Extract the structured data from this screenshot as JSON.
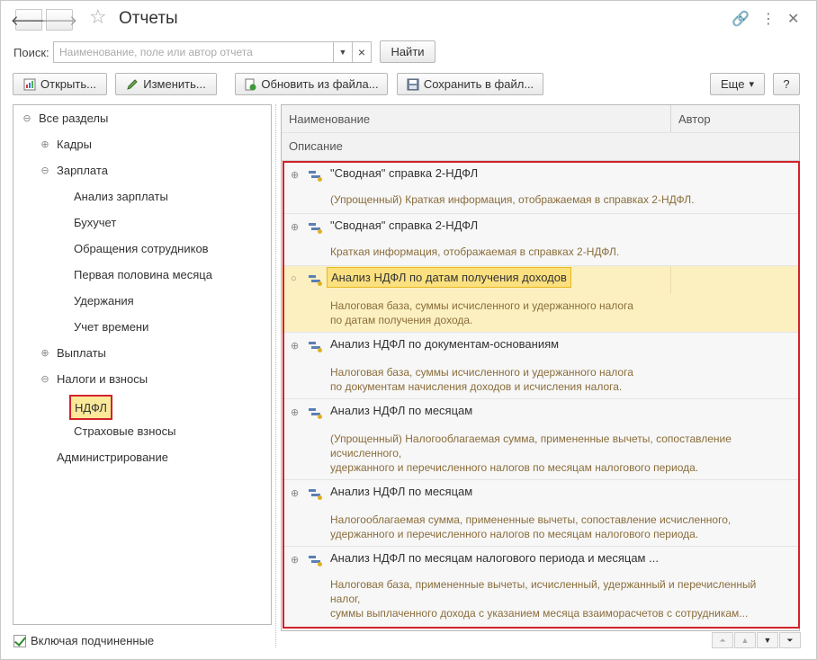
{
  "window": {
    "title": "Отчеты",
    "back_glyph": "🡐",
    "forward_glyph": "🡒",
    "star_glyph": "☆",
    "link_glyph": "🔗",
    "more_glyph": "⋮",
    "close_glyph": "✕"
  },
  "search": {
    "label": "Поиск:",
    "placeholder": "Наименование, поле или автор отчета",
    "dropdown_glyph": "▼",
    "clear_glyph": "×",
    "find_label": "Найти"
  },
  "toolbar": {
    "open_label": "Открыть...",
    "edit_label": "Изменить...",
    "update_label": "Обновить из файла...",
    "save_label": "Сохранить в файл...",
    "more_label": "Еще",
    "more_arrow": "▾",
    "help_label": "?"
  },
  "tree": {
    "items": [
      {
        "label": "Все разделы",
        "toggle": "⊖"
      },
      {
        "label": "Кадры",
        "toggle": "⊕"
      },
      {
        "label": "Зарплата",
        "toggle": "⊖"
      },
      {
        "label": "Анализ зарплаты"
      },
      {
        "label": "Бухучет"
      },
      {
        "label": "Обращения сотрудников"
      },
      {
        "label": "Первая половина месяца"
      },
      {
        "label": "Удержания"
      },
      {
        "label": "Учет времени"
      },
      {
        "label": "Выплаты",
        "toggle": "⊕"
      },
      {
        "label": "Налоги и взносы",
        "toggle": "⊖"
      },
      {
        "label": "НДФЛ"
      },
      {
        "label": "Страховые взносы"
      },
      {
        "label": "Администрирование"
      }
    ],
    "include_subordinate_label": "Включая подчиненные"
  },
  "table": {
    "col_name": "Наименование",
    "col_author": "Автор",
    "col_description": "Описание",
    "rows": [
      {
        "toggle": "⊕",
        "name": "\"Сводная\" справка 2-НДФЛ",
        "desc1": "(Упрощенный) Краткая информация, отображаемая в справках 2-НДФЛ.",
        "desc2": "",
        "desc3": ""
      },
      {
        "toggle": "⊕",
        "name": "\"Сводная\" справка 2-НДФЛ",
        "desc1": "Краткая информация, отображаемая в справках 2-НДФЛ.",
        "desc2": "",
        "desc3": ""
      },
      {
        "toggle": "○",
        "name": "Анализ НДФЛ по датам получения доходов",
        "desc1": "Налоговая база, суммы исчисленного и удержанного налога",
        "desc2": "по датам получения дохода.",
        "desc3": ""
      },
      {
        "toggle": "⊕",
        "name": "Анализ НДФЛ по документам-основаниям",
        "desc1": "Налоговая база, суммы исчисленного и удержанного налога",
        "desc2": "по документам начисления доходов и исчисления налога.",
        "desc3": ""
      },
      {
        "toggle": "⊕",
        "name": "Анализ НДФЛ по месяцам",
        "desc1": "(Упрощенный) Налогооблагаемая сумма, примененные вычеты, сопоставление",
        "desc2": "исчисленного,",
        "desc3": "удержанного и перечисленного налогов по месяцам налогового периода."
      },
      {
        "toggle": "⊕",
        "name": "Анализ НДФЛ по месяцам",
        "desc1": "Налогооблагаемая сумма, примененные вычеты, сопоставление исчисленного,",
        "desc2": "удержанного и перечисленного налогов по месяцам налогового периода.",
        "desc3": ""
      },
      {
        "toggle": "⊕",
        "name": "Анализ НДФЛ по месяцам налогового периода и месяцам ...",
        "desc1": "Налоговая база, примененные вычеты, исчисленный, удержанный и перечисленный",
        "desc2": "налог,",
        "desc3": "суммы выплаченного дохода с указанием месяца взаиморасчетов с сотрудникам..."
      }
    ]
  },
  "scroll": {
    "first_glyph": "⏶",
    "up_glyph": "▲",
    "down_glyph": "▼",
    "last_glyph": "⏷"
  },
  "colors": {
    "selection_bg": "#fbe99a",
    "highlight_border": "#d2232a",
    "description_text": "#8a6d3b"
  }
}
